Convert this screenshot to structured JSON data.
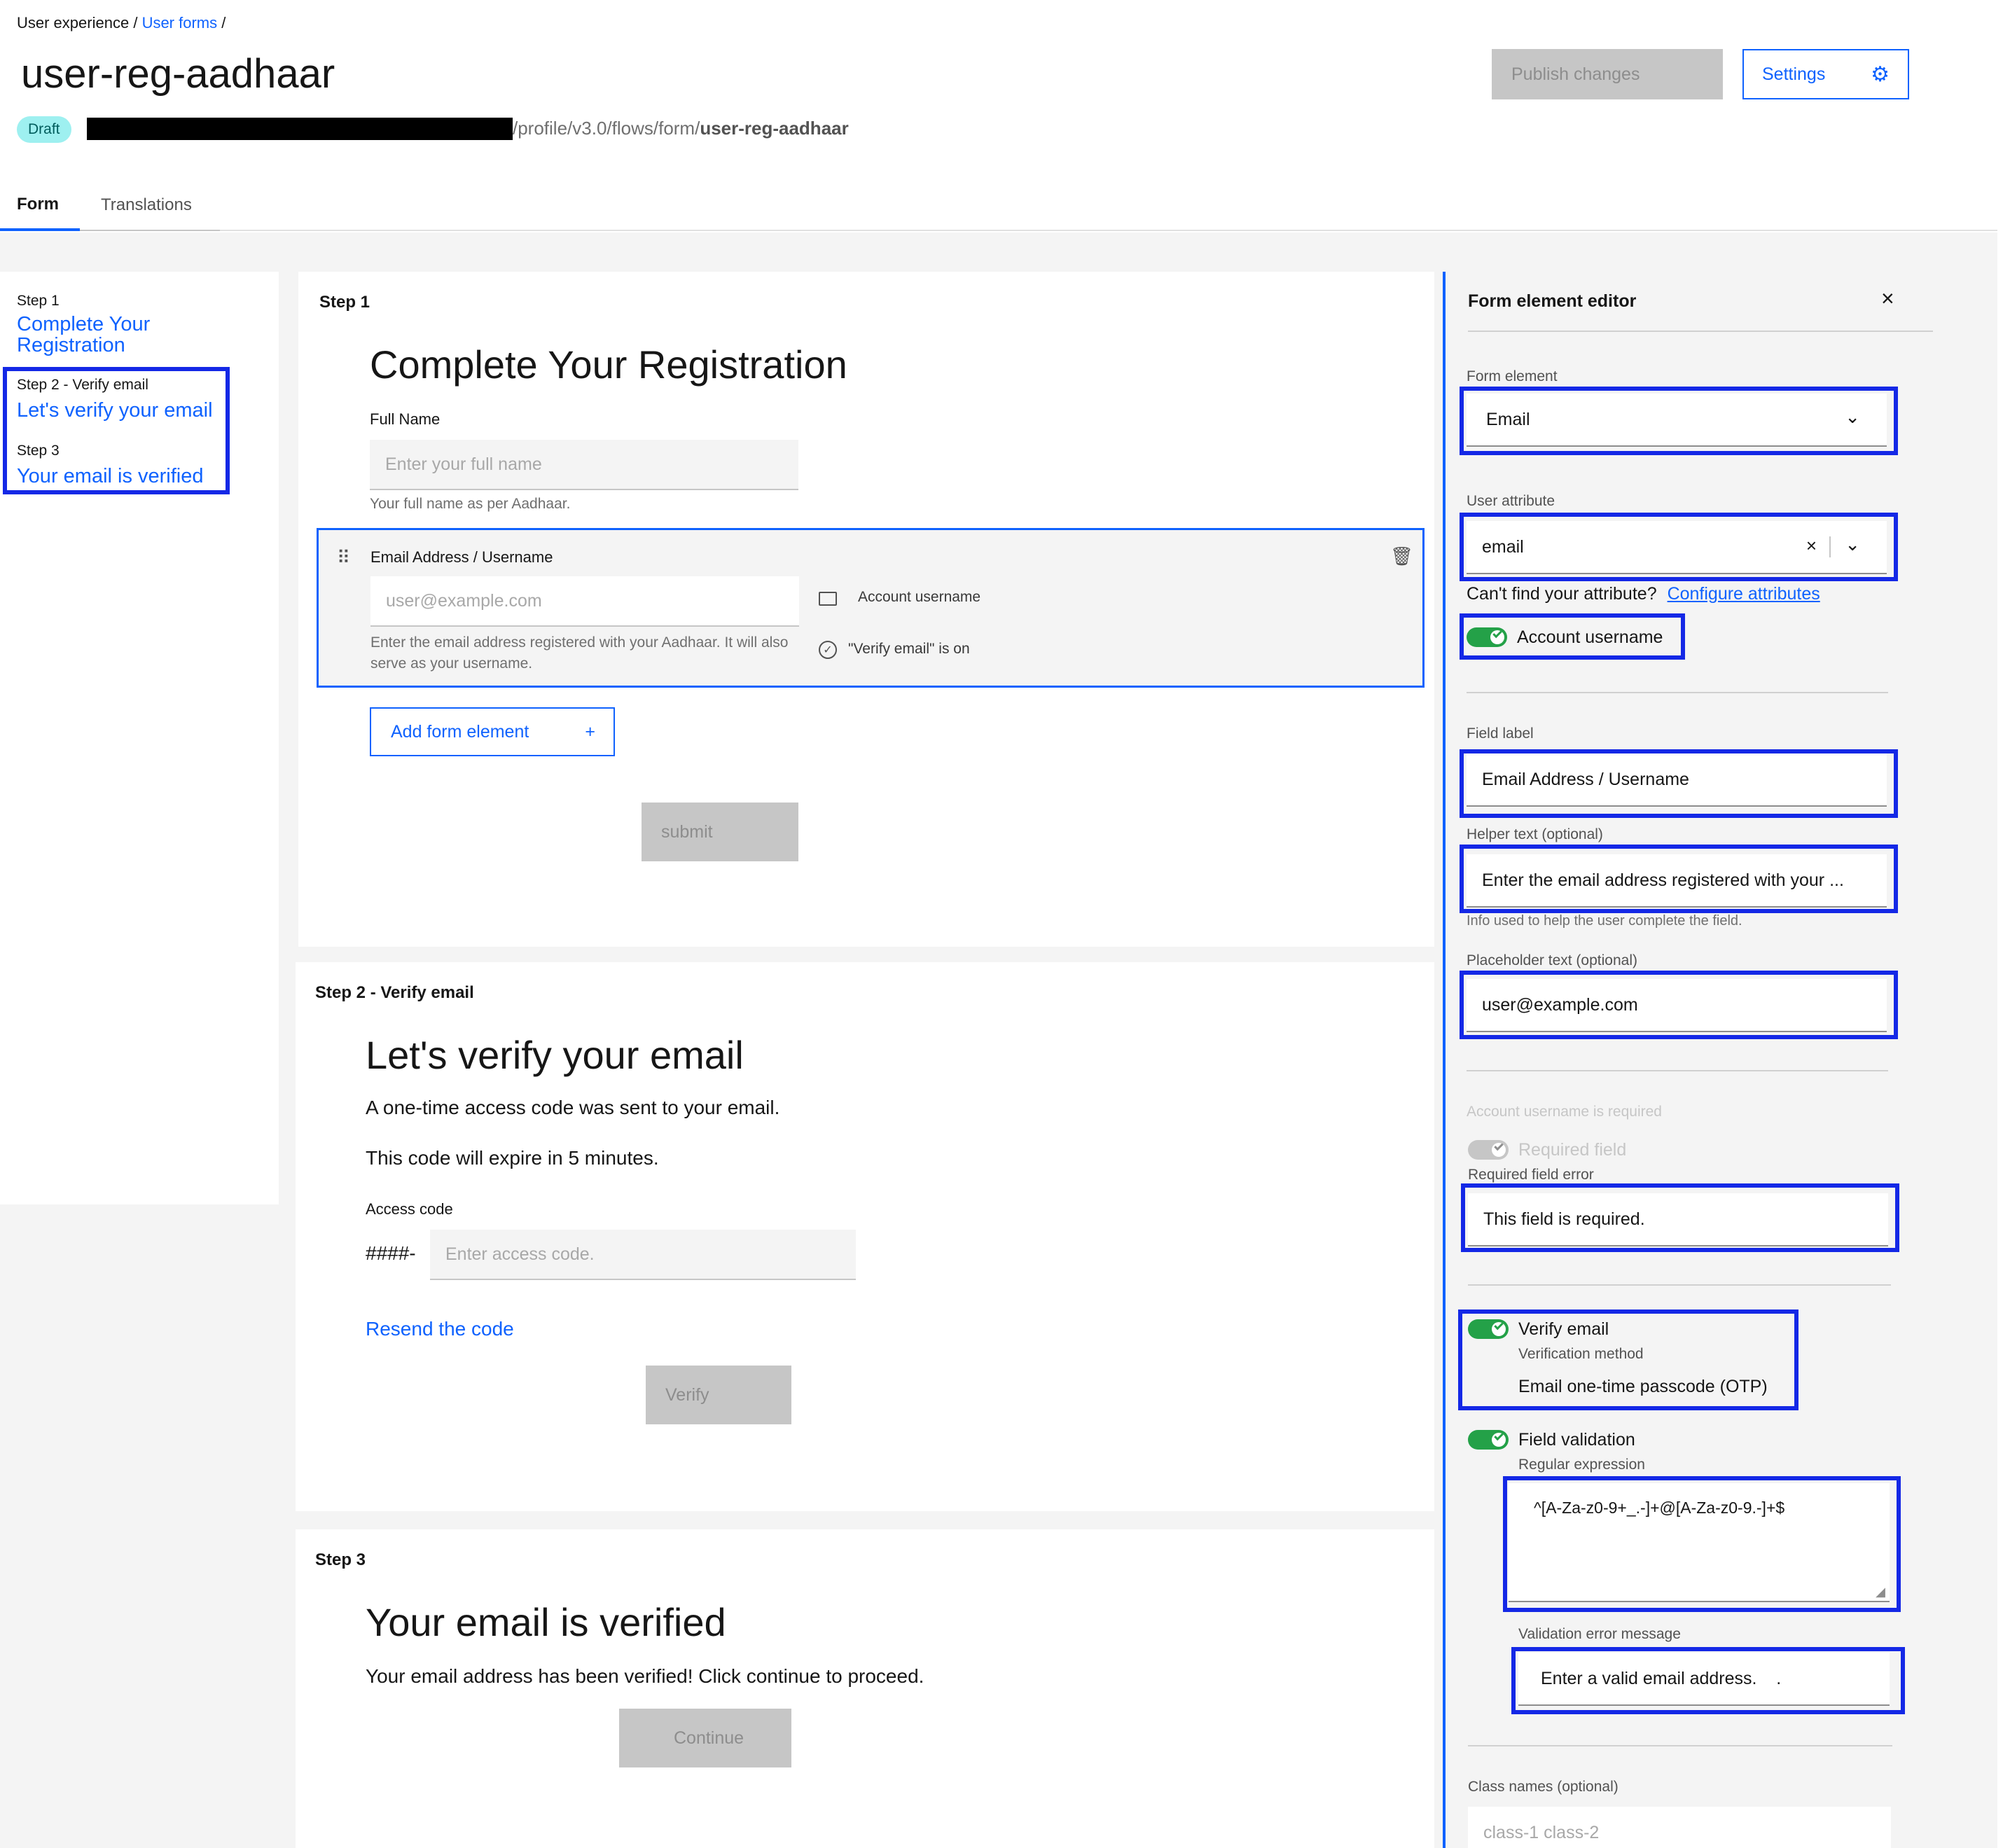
{
  "breadcrumb": {
    "item1": "User experience",
    "sep1": "/",
    "item2": "User forms",
    "sep2": "/"
  },
  "page": {
    "title": "user-reg-aadhaar",
    "status_badge": "Draft",
    "url_path_prefix": "/profile/v3.0/flows/form/",
    "url_path_name": "user-reg-aadhaar"
  },
  "header_actions": {
    "publish_label": "Publish changes",
    "settings_label": "Settings",
    "settings_icon": "gear-icon"
  },
  "tabs": [
    {
      "label": "Form",
      "active": true
    },
    {
      "label": "Translations",
      "active": false
    }
  ],
  "steps_nav": [
    {
      "step": "Step 1",
      "title": "Complete Your Registration"
    },
    {
      "step": "Step 2 - Verify email",
      "title": "Let's verify your email"
    },
    {
      "step": "Step 3",
      "title": "Your email is verified"
    }
  ],
  "step1": {
    "heading": "Step 1",
    "title": "Complete Your Registration",
    "full_name_label": "Full Name",
    "full_name_placeholder": "Enter your full name",
    "full_name_helper": "Your full name as per Aadhaar.",
    "email_label": "Email Address / Username",
    "email_placeholder": "user@example.com",
    "email_helper": "Enter the email address registered with your Aadhaar. It will also serve as your username.",
    "tag_account_username": "Account username",
    "tag_verify_email": "\"Verify email\" is on",
    "add_element_label": "Add form element",
    "add_element_icon": "+",
    "submit_label": "submit"
  },
  "step2": {
    "heading": "Step 2 - Verify email",
    "title": "Let's verify your email",
    "line1": "A one-time access code was sent to your email.",
    "line2": "This code will expire in 5 minutes.",
    "access_code_label": "Access code",
    "access_code_prefix": "####-",
    "access_code_placeholder": "Enter access code.",
    "resend_label": "Resend the code",
    "verify_label": "Verify"
  },
  "step3": {
    "heading": "Step 3",
    "title": "Your email is verified",
    "text": "Your email address has been verified! Click continue to proceed.",
    "continue_label": "Continue"
  },
  "editor": {
    "title": "Form element editor",
    "close_icon": "×",
    "form_element_label": "Form element",
    "form_element_value": "Email",
    "user_attribute_label": "User attribute",
    "user_attribute_value": "email",
    "cant_find_text": "Can't find your attribute?",
    "configure_link": "Configure attributes",
    "account_username_toggle": "Account username",
    "field_label_label": "Field label",
    "field_label_value": "Email Address / Username",
    "helper_label": "Helper text (optional)",
    "helper_value": "Enter the email address registered with your ...",
    "helper_hint": "Info used to help the user complete the field.",
    "placeholder_label": "Placeholder text (optional)",
    "placeholder_value": "user@example.com",
    "account_username_required": "Account username is required",
    "required_toggle": "Required field",
    "required_error_label": "Required field error",
    "required_error_value": "This field is required.",
    "verify_email_toggle": "Verify email",
    "verification_method_label": "Verification method",
    "verification_method_value": "Email one-time passcode (OTP)",
    "field_validation_toggle": "Field validation",
    "regex_label": "Regular expression",
    "regex_value": "^[A-Za-z0-9+_.-]+@[A-Za-z0-9.-]+$",
    "validation_error_label": "Validation error message",
    "validation_error_value": "Enter a valid email address.    .",
    "class_names_label": "Class names (optional)",
    "class_names_placeholder": "class-1 class-2"
  },
  "colors": {
    "accent": "#0f62fe",
    "highlight_box": "#1428e6",
    "toggle_on": "#24a148",
    "badge_bg": "#9ef0f0"
  }
}
